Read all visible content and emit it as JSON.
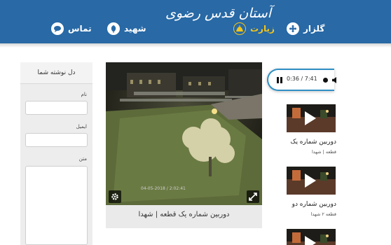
{
  "header": {
    "logo_text": "آستان قدس رضوی",
    "nav": [
      {
        "label": "گلزار",
        "icon": "flower-icon"
      },
      {
        "label": "زیارت",
        "icon": "dome-icon",
        "active": true
      },
      {
        "label": "شهید",
        "icon": "tulip-icon"
      },
      {
        "label": "تماس",
        "icon": "chat-icon"
      }
    ]
  },
  "form": {
    "title": "دل نوشته شما",
    "name_label": "نام",
    "email_label": "ایمیل",
    "text_label": "متن"
  },
  "camera": {
    "caption": "دوربین شماره یک قطعه | شهدا",
    "timestamp": "04-05-2018 / 2:02:41"
  },
  "player": {
    "time": "0:36 / 7:41"
  },
  "playlist": [
    {
      "title": "دوربین شماره یک",
      "subtitle": "قطعه | شهدا"
    },
    {
      "title": "دوربین شماره دو",
      "subtitle": "قطعه ۲ شهدا"
    },
    {
      "title": "",
      "subtitle": ""
    }
  ],
  "colors": {
    "header_bg": "#2869a6",
    "active_nav": "#f5c518",
    "player_border": "#2e8fc4"
  }
}
